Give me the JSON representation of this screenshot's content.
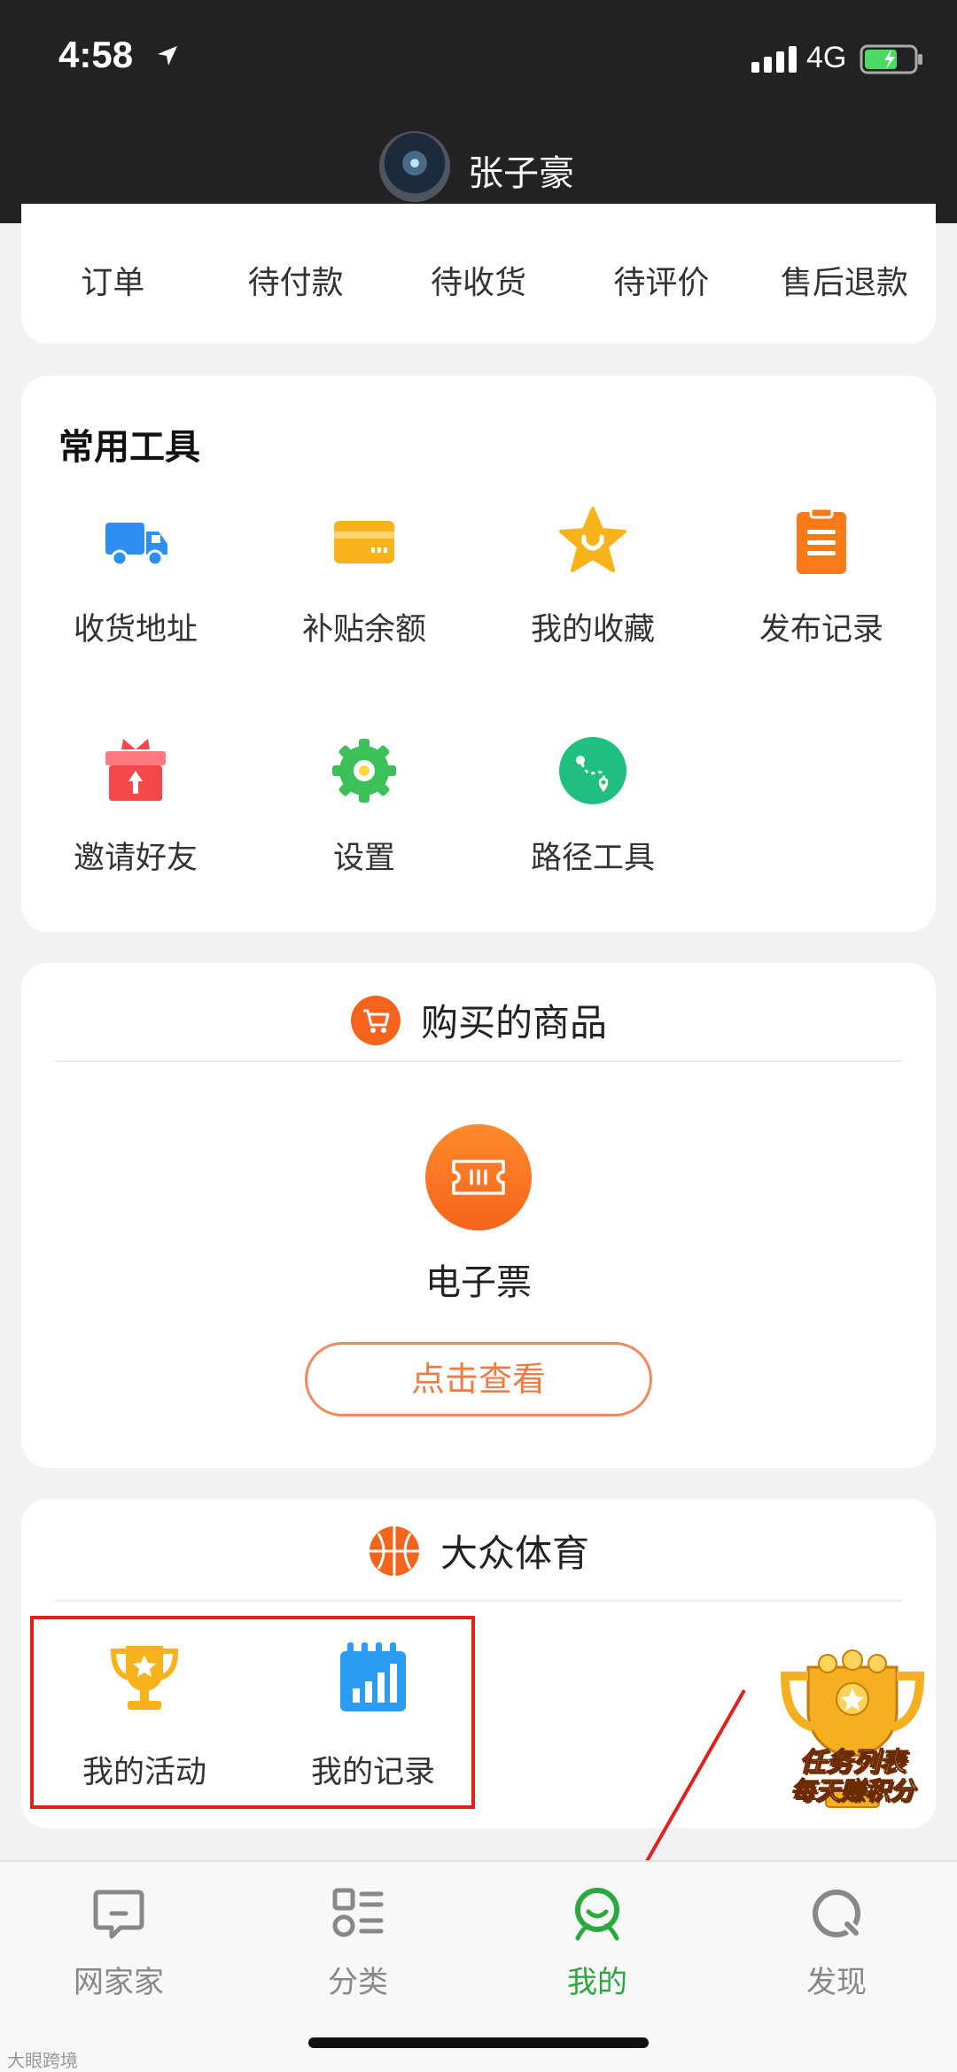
{
  "status": {
    "time": "4:58",
    "network": "4G"
  },
  "header": {
    "user_name": "张子豪"
  },
  "orders": {
    "tabs": [
      "订单",
      "待付款",
      "待收货",
      "待评价",
      "售后退款"
    ]
  },
  "tools": {
    "title": "常用工具",
    "items": [
      {
        "label": "收货地址",
        "icon": "truck-icon",
        "color": "#2f8ef2"
      },
      {
        "label": "补贴余额",
        "icon": "card-icon",
        "color": "#f8b31c"
      },
      {
        "label": "我的收藏",
        "icon": "star-icon",
        "color": "#f8b31c"
      },
      {
        "label": "发布记录",
        "icon": "clipboard-icon",
        "color": "#fa7a17"
      },
      {
        "label": "邀请好友",
        "icon": "gift-icon",
        "color": "#f4484d"
      },
      {
        "label": "设置",
        "icon": "gear-icon",
        "color": "#3cc05a"
      },
      {
        "label": "路径工具",
        "icon": "route-icon",
        "color": "#1fc07f"
      }
    ]
  },
  "purchased": {
    "title": "购买的商品",
    "ticket_label": "电子票",
    "view_button": "点击查看"
  },
  "sports": {
    "title": "大众体育",
    "items": [
      {
        "label": "我的活动",
        "icon": "trophy-icon"
      },
      {
        "label": "我的记录",
        "icon": "chart-calendar-icon"
      }
    ]
  },
  "task_badge": {
    "line1": "任务列表",
    "line2": "每天赚积分"
  },
  "tabbar": {
    "items": [
      {
        "label": "网家家",
        "icon": "chat-bubble-icon",
        "active": false
      },
      {
        "label": "分类",
        "icon": "category-icon",
        "active": false
      },
      {
        "label": "我的",
        "icon": "profile-smile-icon",
        "active": true
      },
      {
        "label": "发现",
        "icon": "discover-icon",
        "active": false
      }
    ]
  },
  "watermark": "大眼跨境",
  "colors": {
    "active_tab": "#2aa93e",
    "accent_orange": "#f5641d",
    "highlight_red": "#e2211c"
  }
}
